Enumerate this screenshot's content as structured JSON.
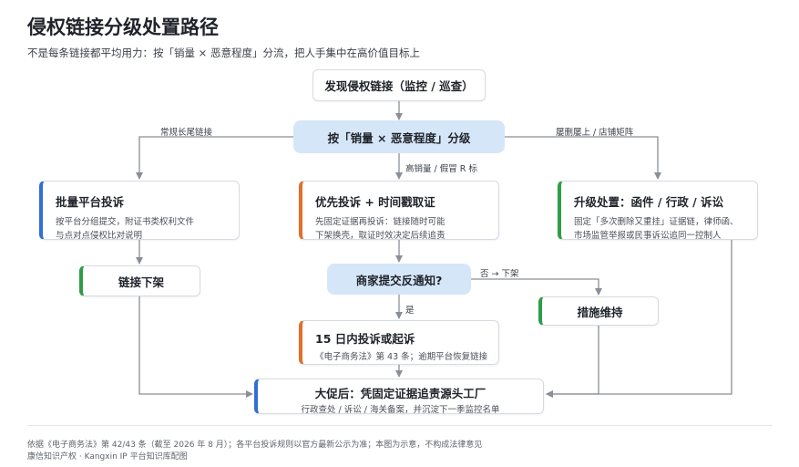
{
  "header": {
    "title": "侵权链接分级处置路径",
    "subtitle": "不是每条链接都平均用力：按「销量 × 恶意程度」分流，把人手集中在高价值目标上"
  },
  "nodes": {
    "discover": "发现侵权链接（监控 / 巡查）",
    "classify": "按「销量 × 恶意程度」分级",
    "bulk": {
      "title": "批量平台投诉",
      "desc1": "按平台分组提交，附证书类权利文件",
      "desc2": "与点对点侵权比对说明"
    },
    "priority": {
      "title": "优先投诉 + 时间戳取证",
      "desc1": "先固定证据再投诉：链接随时可能",
      "desc2": "下架换壳，取证时效决定后续追责"
    },
    "escalate": {
      "title": "升级处置：函件 / 行政 / 诉讼",
      "desc1": "固定「多次删除又重挂」证据链，律师函、",
      "desc2": "市场监管举报或民事诉讼追同一控制人"
    },
    "takedown": "链接下架",
    "counter": "商家提交反通知?",
    "maintain": "措施维持",
    "sue": {
      "title": "15 日内投诉或起诉",
      "desc": "《电子商务法》第 43 条；逾期平台恢复链接"
    },
    "final": {
      "title": "大促后：凭固定证据追责源头工厂",
      "desc": "行政查处 / 诉讼 / 海关备案，并沉淀下一季监控名单"
    }
  },
  "edges": {
    "long_tail": "常规长尾链接",
    "high_volume": "高销量 / 假冒 R 标",
    "repeat": "屡删屡上 / 店铺矩阵",
    "no": "否 → 下架",
    "yes": "是"
  },
  "colors": {
    "blue": "#2f6fd6",
    "orange": "#e0702a",
    "green": "#2e9e46",
    "classify_fill": "#d6e6f9",
    "counter_fill": "#d6e6f9"
  },
  "footer": {
    "note": "依据《电子商务法》第 42/43 条（截至 2026 年 8 月）；各平台投诉规则以官方最新公示为准；本图为示意，不构成法律意见",
    "credit": "康信知识产权 · Kangxin IP 平台知识库配图"
  }
}
